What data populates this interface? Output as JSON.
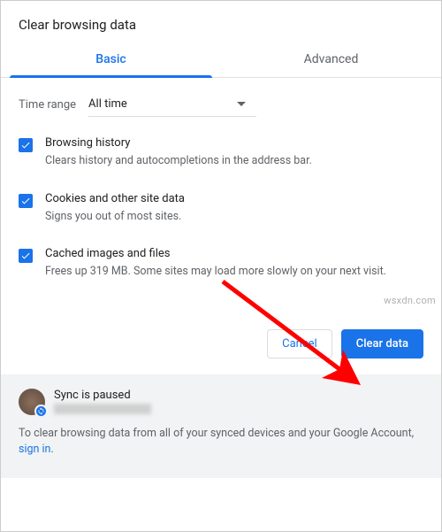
{
  "dialog": {
    "title": "Clear browsing data"
  },
  "tabs": {
    "basic": "Basic",
    "advanced": "Advanced"
  },
  "timeRange": {
    "label": "Time range",
    "value": "All time"
  },
  "options": {
    "history": {
      "title": "Browsing history",
      "desc": "Clears history and autocompletions in the address bar."
    },
    "cookies": {
      "title": "Cookies and other site data",
      "desc": "Signs you out of most sites."
    },
    "cache": {
      "title": "Cached images and files",
      "desc": "Frees up 319 MB. Some sites may load more slowly on your next visit."
    }
  },
  "buttons": {
    "cancel": "Cancel",
    "clear": "Clear data"
  },
  "sync": {
    "status": "Sync is paused",
    "footerMsg": "To clear browsing data from all of your synced devices and your Google Account, ",
    "signIn": "sign in",
    "period": "."
  },
  "watermark": "wsxdn.com"
}
